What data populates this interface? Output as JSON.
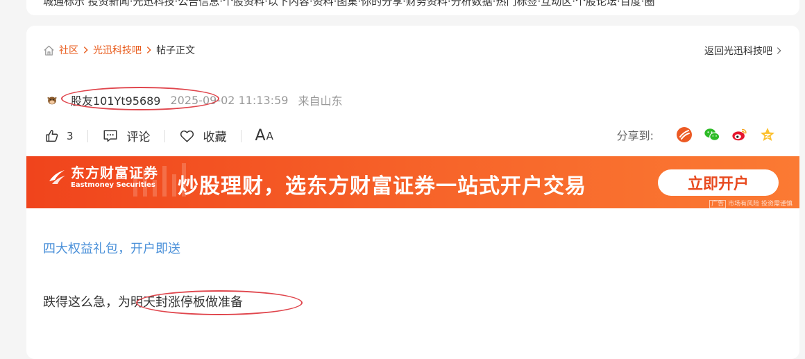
{
  "top_strip_text": "城通标示 投资新闻·光迅科技·公告信息·个股资料·以下内容·资料·图集·你的分享·财务资料·分析数据·热门标签·互动区·个股论坛·百度·圈",
  "breadcrumb": {
    "items": [
      "社区",
      "光迅科技吧"
    ],
    "current": "帖子正文",
    "back_label": "返回光迅科技吧"
  },
  "post_meta": {
    "author": "股友101Yt95689",
    "time": "2025-09-02 11:13:59",
    "origin": "来自山东"
  },
  "actions": {
    "like_count": "3",
    "comment_label": "评论",
    "collect_label": "收藏",
    "font_big": "A",
    "font_small": "A"
  },
  "share": {
    "label": "分享到:",
    "icons": [
      "eastmoney-icon",
      "wechat-icon",
      "weibo-icon",
      "qzone-icon"
    ]
  },
  "ad": {
    "logo_cn": "东方财富证券",
    "logo_en": "Eastmoney Securities",
    "slogan": "炒股理财，选东方财富证券一站式开户交易",
    "button": "立即开户",
    "tag": "广告",
    "disclaimer": "市场有风险 投资需谨慎"
  },
  "content": {
    "promo_link": "四大权益礼包，开户即送",
    "text": "跌得这么急，为明天封涨停板做准备"
  },
  "colors": {
    "accent": "#e85a1a",
    "link": "#4a90d9",
    "annotation": "#e0464d",
    "ad_orange": "#f0441c"
  }
}
